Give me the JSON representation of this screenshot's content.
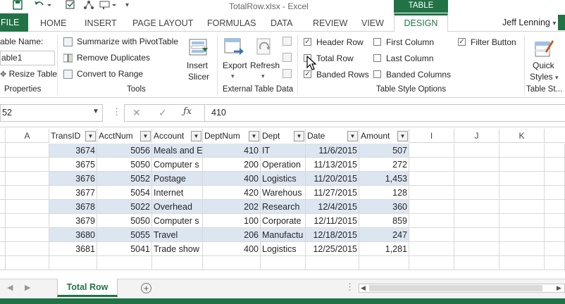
{
  "title": {
    "filename": "TotalRow.xlsx - Excel",
    "context_tab": "TABLE TOOLS"
  },
  "tabs": {
    "file": "FILE",
    "home": "HOME",
    "insert": "INSERT",
    "page_layout": "PAGE LAYOUT",
    "formulas": "FORMULAS",
    "data": "DATA",
    "review": "REVIEW",
    "view": "VIEW",
    "design": "DESIGN"
  },
  "user": "Jeff Lenning",
  "ribbon": {
    "properties": {
      "name_label": "able Name:",
      "name_value": "able1",
      "resize": "Resize Table",
      "group": "Properties"
    },
    "tools": {
      "pivot": "Summarize with PivotTable",
      "dups": "Remove Duplicates",
      "range": "Convert to Range",
      "slicer_1": "Insert",
      "slicer_2": "Slicer",
      "group": "Tools"
    },
    "external": {
      "export": "Export",
      "refresh": "Refresh",
      "group": "External Table Data"
    },
    "options": {
      "header_row": "Header Row",
      "total_row": "Total Row",
      "banded_rows": "Banded Rows",
      "first_col": "First Column",
      "last_col": "Last Column",
      "banded_cols": "Banded Columns",
      "filter_btn": "Filter Button",
      "group": "Table Style Options"
    },
    "styles": {
      "quick_1": "Quick",
      "quick_2": "Styles",
      "group": "Table St..."
    }
  },
  "formula_bar": {
    "name_box": "52",
    "value": "410"
  },
  "columns": {
    "a": "A",
    "i": "I",
    "j": "J",
    "k": "K",
    "headers": [
      "TransID",
      "AcctNum",
      "Account",
      "DeptNum",
      "Dept",
      "Date",
      "Amount"
    ]
  },
  "rows": [
    [
      "3674",
      "5056",
      "Meals and E",
      "410",
      "IT",
      "11/6/2015",
      "507"
    ],
    [
      "3675",
      "5050",
      "Computer s",
      "200",
      "Operation",
      "11/13/2015",
      "272"
    ],
    [
      "3676",
      "5052",
      "Postage",
      "400",
      "Logistics",
      "11/20/2015",
      "1,453"
    ],
    [
      "3677",
      "5054",
      "Internet",
      "420",
      "Warehous",
      "11/27/2015",
      "128"
    ],
    [
      "3678",
      "5022",
      "Overhead",
      "202",
      "Research",
      "12/4/2015",
      "360"
    ],
    [
      "3679",
      "5050",
      "Computer s",
      "100",
      "Corporate",
      "12/11/2015",
      "859"
    ],
    [
      "3680",
      "5055",
      "Travel",
      "206",
      "Manufactu",
      "12/18/2015",
      "247"
    ],
    [
      "3681",
      "5041",
      "Trade show",
      "400",
      "Logistics",
      "12/25/2015",
      "1,281"
    ]
  ],
  "sheet": {
    "tab": "Total Row"
  },
  "colors": {
    "excel_green": "#217346",
    "band": "#dce6f1"
  }
}
